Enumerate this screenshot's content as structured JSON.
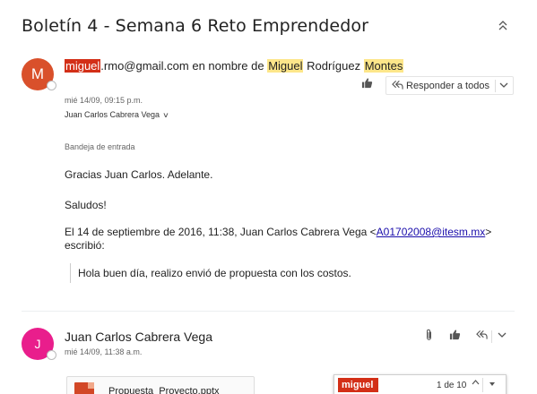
{
  "thread": {
    "subject": "Boletín 4 - Semana 6 Reto Emprendedor"
  },
  "message1": {
    "avatar_letter": "M",
    "sender_part_highlighted_red": "miguel",
    "sender_part_1": ".rmo@gmail.com en nombre de ",
    "sender_part_highlighted_1": "Miguel",
    "sender_part_2": " Rodríguez ",
    "sender_part_highlighted_2": "Montes",
    "date": "mié 14/09, 09:15 p.m.",
    "to": "Juan Carlos Cabrera Vega",
    "folder": "Bandeja de entrada",
    "reply_all_label": "Responder a todos",
    "body_line_1": "Gracias Juan Carlos. Adelante.",
    "body_line_2": "Saludos!",
    "quote_header_prefix": "El 14 de septiembre de 2016, 11:38, Juan Carlos Cabrera Vega <",
    "quote_header_email": "A01702008@itesm.mx",
    "quote_header_suffix": "> escribió:",
    "quoted_text": "Hola buen día, realizo envió de propuesta con los costos."
  },
  "message2": {
    "avatar_letter": "J",
    "sender": "Juan Carlos Cabrera Vega",
    "date": "mié 14/09, 11:38 a.m.",
    "attachment_name": "Propuesta_Proyecto.pptx"
  },
  "find_bar": {
    "term": "miguel",
    "count": "1 de 10"
  },
  "colors": {
    "avatar_m": "#d9502b",
    "avatar_j": "#e91e8c",
    "highlight_red": "#d32f17",
    "highlight_yellow": "#fde68a",
    "link": "#1a0dab"
  },
  "icons": {
    "collapse": "collapse-icon",
    "like": "thumbs-up-icon",
    "reply_all": "reply-all-icon",
    "dropdown": "chevron-down-icon",
    "attachment": "paperclip-icon",
    "powerpoint": "powerpoint-file-icon"
  }
}
